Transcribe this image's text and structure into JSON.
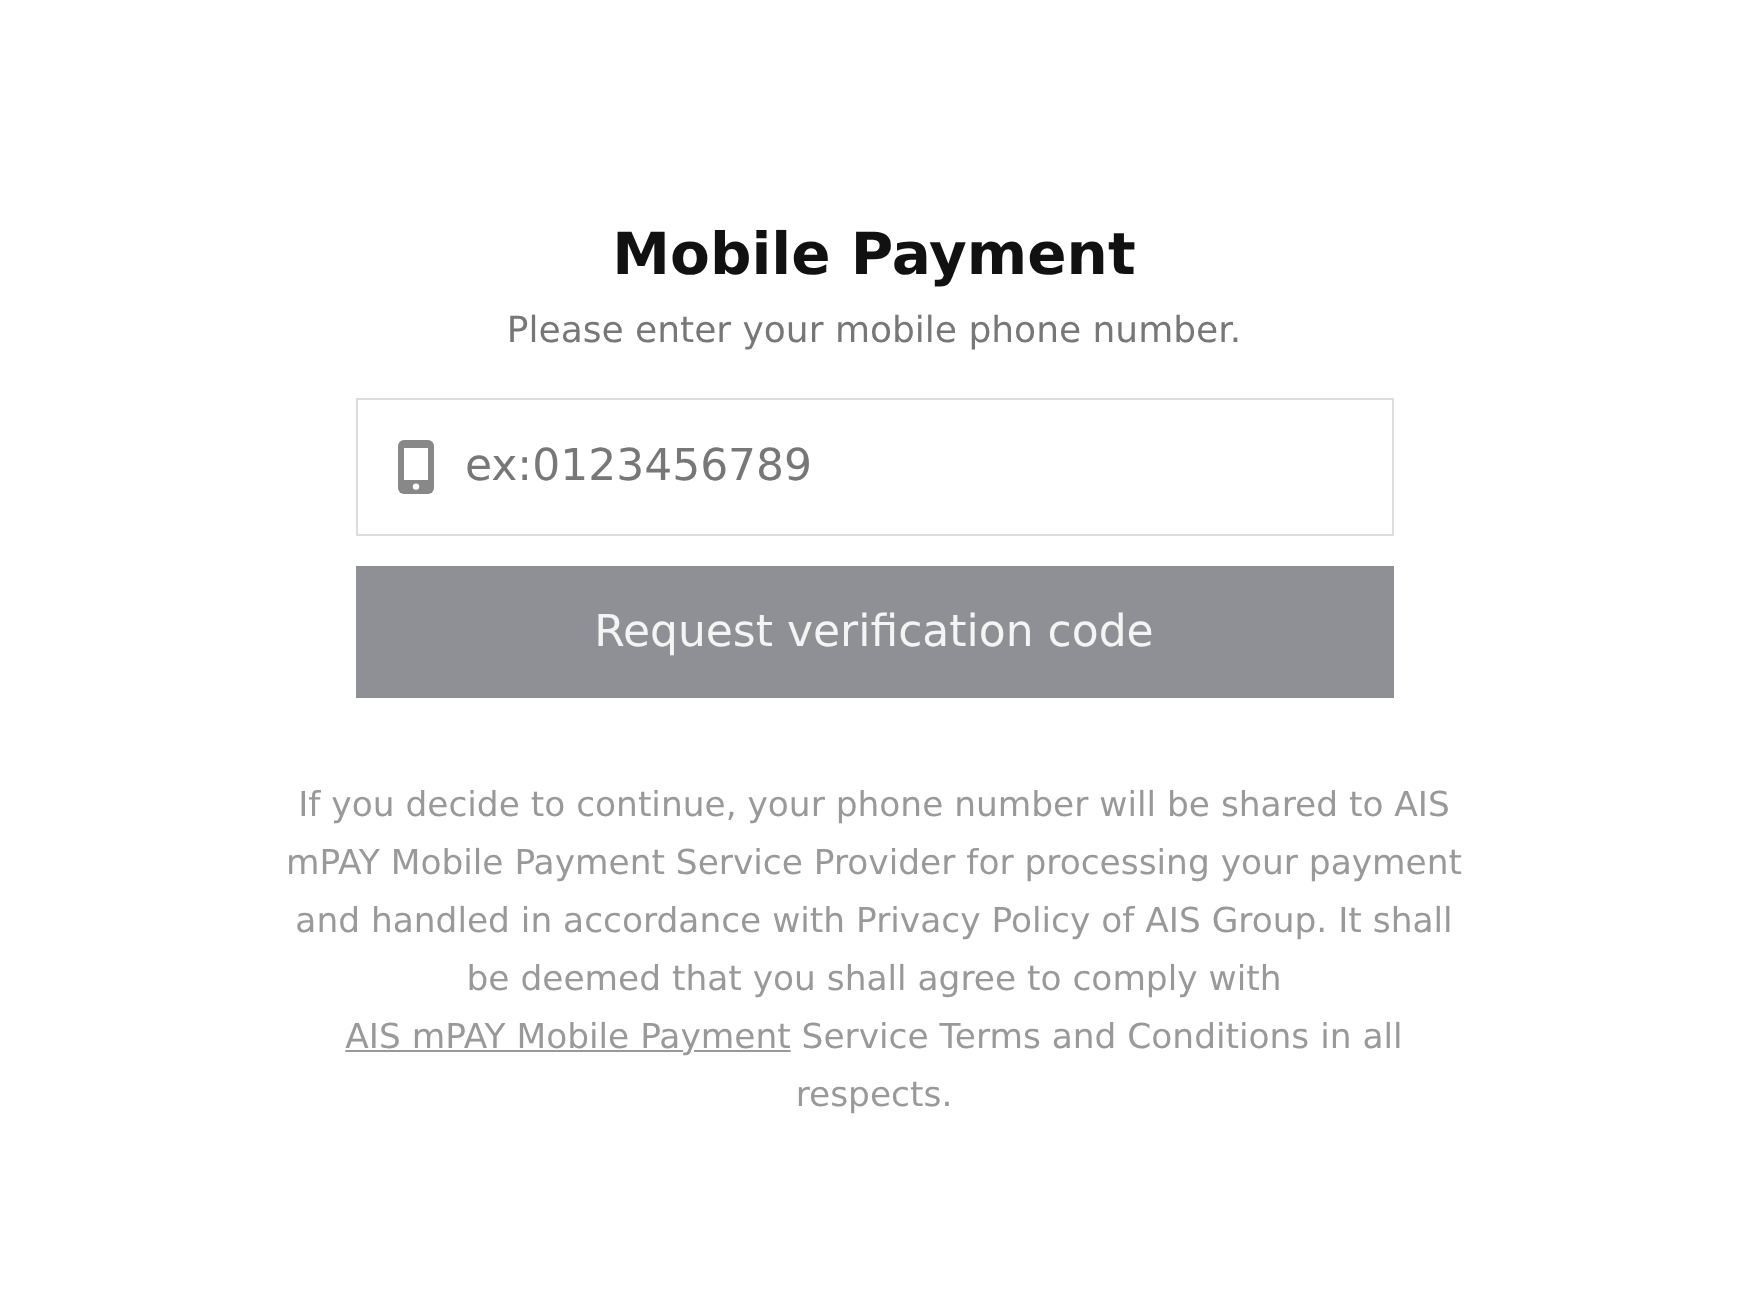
{
  "title": "Mobile Payment",
  "subtitle": "Please enter your mobile phone number.",
  "phone_field": {
    "placeholder": "ex:0123456789"
  },
  "submit_button": {
    "label": "Request verification code",
    "disabled": true
  },
  "notice": {
    "text_before": "If you decide to continue, your phone number will be shared to AIS mPAY Mobile Payment Service Provider for processing your payment and handled in accordance with Privacy Policy of AIS Group. It shall be deemed that you shall agree to comply with ",
    "link": "AIS mPAY Mobile Payment",
    "text_after": " Service Terms and Conditions in all respects."
  }
}
